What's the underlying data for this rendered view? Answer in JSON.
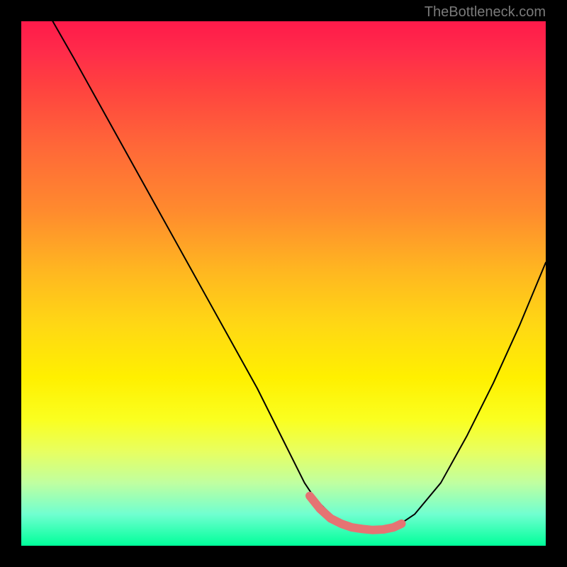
{
  "attribution": "TheBottleneck.com",
  "chart_data": {
    "type": "line",
    "title": "",
    "xlabel": "",
    "ylabel": "",
    "xlim": [
      0,
      100
    ],
    "ylim": [
      0,
      100
    ],
    "series": [
      {
        "name": "curve",
        "x": [
          6,
          10,
          15,
          20,
          25,
          30,
          35,
          40,
          45,
          50,
          54,
          56,
          58,
          60,
          62,
          64,
          66,
          68,
          70,
          72,
          75,
          80,
          85,
          90,
          95,
          100
        ],
        "values": [
          100,
          93,
          84,
          75,
          66,
          57,
          48,
          39,
          30,
          20,
          12,
          9,
          7,
          5,
          4,
          3.2,
          3,
          3,
          3.2,
          4,
          6,
          12,
          21,
          31,
          42,
          54
        ]
      },
      {
        "name": "highlight",
        "x": [
          55,
          57,
          59,
          61,
          63,
          65,
          67,
          69,
          71,
          72.5
        ],
        "values": [
          9.5,
          7,
          5.2,
          4.2,
          3.5,
          3.2,
          3.0,
          3.1,
          3.5,
          4.2
        ]
      }
    ],
    "annotations": []
  },
  "colors": {
    "curve": "#000000",
    "highlight": "#e57373"
  }
}
